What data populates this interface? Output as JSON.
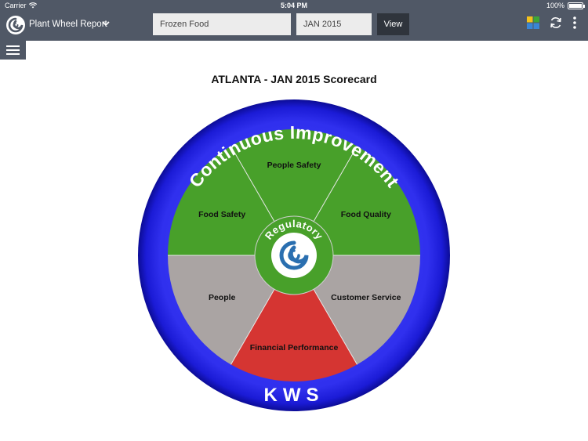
{
  "status_bar": {
    "carrier": "Carrier",
    "time": "5:04 PM",
    "battery": "100%"
  },
  "header": {
    "app_title": "Plant Wheel Report",
    "category_value": "Frozen Food",
    "period_value": "JAN 2015",
    "view_label": "View",
    "icons": [
      "app-logo-icon",
      "chevron-down-icon",
      "color-grid-icon",
      "refresh-icon",
      "more-vertical-icon",
      "menu-icon"
    ]
  },
  "scorecard": {
    "title": "ATLANTA - JAN 2015 Scorecard",
    "ring_top_text": "Continuous Improvement",
    "ring_bottom_text": "KWS",
    "center_label": "Regulatory",
    "segments": [
      {
        "label": "People Safety",
        "status_color": "#48a02a"
      },
      {
        "label": "Food Quality",
        "status_color": "#48a02a"
      },
      {
        "label": "Customer Service",
        "status_color": "#aaa4a3"
      },
      {
        "label": "Financial Performance",
        "status_color": "#d53532"
      },
      {
        "label": "People",
        "status_color": "#aaa4a3"
      },
      {
        "label": "Food Safety",
        "status_color": "#48a02a"
      }
    ],
    "colors": {
      "ring": "#1f1fe6",
      "center": "#48a02a"
    }
  }
}
